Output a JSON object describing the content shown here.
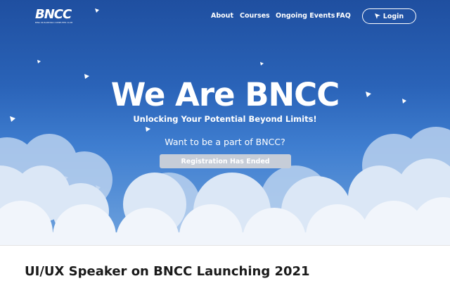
{
  "header": {
    "logo_text": "BNCC",
    "logo_tagline": "BINA NUSANTARA COMPUTER CLUB",
    "nav": [
      {
        "label": "About"
      },
      {
        "label": "Courses"
      },
      {
        "label": "Ongoing Events"
      },
      {
        "label": "FAQ"
      }
    ],
    "login_label": "Login",
    "login_icon": "login-arrow-icon"
  },
  "hero": {
    "title": "We Are BNCC",
    "subtitle": "Unlocking Your Potential Beyond Limits!",
    "question": "Want to be a part of BNCC?",
    "registration_button": "Registration Has Ended",
    "background_colors": [
      "#1f4fa0",
      "#3f7ed0",
      "#6fa3de"
    ],
    "decoration_icon": "paper-plane-icon"
  },
  "article": {
    "title": "UI/UX Speaker on BNCC Launching 2021"
  }
}
